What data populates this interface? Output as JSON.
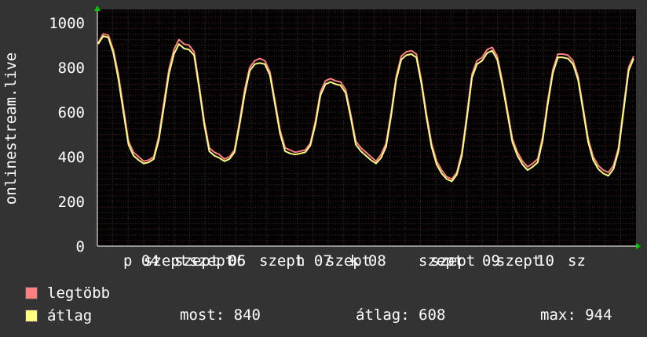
{
  "chart_data": {
    "type": "line",
    "ylabel": "onlinestream.live",
    "ylim": [
      0,
      1060
    ],
    "yticks": [
      0,
      200,
      400,
      600,
      800,
      1000
    ],
    "xticks": [
      "p 04",
      "szept",
      "szept 05",
      "szept",
      "06",
      "szept",
      "h 07",
      "szept",
      "k 08",
      "szept",
      "szept",
      "09",
      "szept",
      "10",
      "sz"
    ],
    "grid": true,
    "series": [
      {
        "name": "legtöbb",
        "color": "#ff7f7f",
        "values": [
          910,
          950,
          945,
          880,
          770,
          620,
          470,
          420,
          400,
          380,
          385,
          400,
          490,
          640,
          790,
          880,
          925,
          905,
          900,
          870,
          720,
          560,
          440,
          420,
          410,
          390,
          400,
          430,
          560,
          700,
          800,
          830,
          840,
          830,
          780,
          650,
          520,
          440,
          430,
          420,
          425,
          430,
          460,
          560,
          690,
          740,
          750,
          740,
          735,
          700,
          590,
          470,
          440,
          420,
          400,
          380,
          410,
          460,
          600,
          760,
          850,
          870,
          875,
          860,
          740,
          590,
          460,
          380,
          340,
          310,
          300,
          330,
          420,
          590,
          770,
          830,
          845,
          880,
          890,
          850,
          740,
          610,
          480,
          420,
          380,
          355,
          370,
          390,
          490,
          650,
          790,
          860,
          860,
          855,
          830,
          760,
          620,
          480,
          400,
          360,
          340,
          330,
          360,
          440,
          620,
          800,
          850
        ]
      },
      {
        "name": "átlag",
        "color": "#ffff7f",
        "values": [
          905,
          940,
          935,
          865,
          750,
          600,
          455,
          405,
          385,
          370,
          375,
          390,
          475,
          620,
          770,
          860,
          905,
          885,
          880,
          855,
          705,
          545,
          425,
          405,
          395,
          380,
          390,
          420,
          545,
          680,
          785,
          815,
          820,
          815,
          765,
          635,
          505,
          425,
          415,
          410,
          415,
          420,
          450,
          545,
          675,
          725,
          735,
          725,
          720,
          685,
          575,
          455,
          425,
          405,
          385,
          370,
          395,
          445,
          585,
          745,
          835,
          855,
          860,
          845,
          725,
          575,
          445,
          365,
          325,
          300,
          290,
          320,
          405,
          575,
          755,
          815,
          830,
          865,
          875,
          835,
          725,
          595,
          465,
          405,
          365,
          340,
          355,
          375,
          475,
          635,
          775,
          845,
          845,
          840,
          815,
          745,
          605,
          465,
          385,
          345,
          325,
          315,
          345,
          425,
          605,
          785,
          840
        ]
      }
    ],
    "stats": {
      "most": "most: 840",
      "atlag": "átlag: 608",
      "max": "max: 944"
    }
  }
}
